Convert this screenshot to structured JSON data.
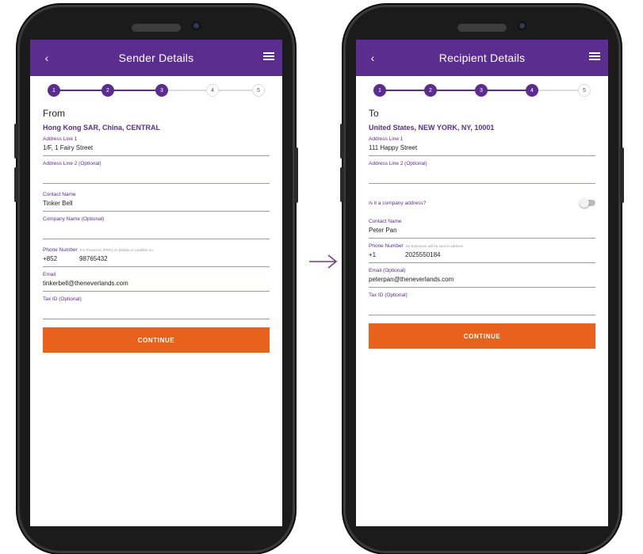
{
  "colors": {
    "brand_purple": "#5b2d8e",
    "cta_orange": "#e8621e",
    "label_purple": "#5b2d8e",
    "arrow": "#7a3d86"
  },
  "sender": {
    "screen_title": "Sender Details",
    "steps": [
      {
        "label": "1",
        "done": true
      },
      {
        "label": "2",
        "done": true
      },
      {
        "label": "3",
        "done": true
      },
      {
        "label": "4",
        "done": false
      },
      {
        "label": "5",
        "done": false
      }
    ],
    "heading": "From",
    "location": "Hong Kong SAR, China,  CENTRAL",
    "address1": {
      "label": "Address Line 1",
      "value": "1/F, 1 Fairy Street"
    },
    "address2": {
      "label": "Address Line 2 (Optional)",
      "value": ""
    },
    "contact": {
      "label": "Contact Name",
      "value": "Tinker Bell"
    },
    "company": {
      "label": "Company Name (Optional)",
      "value": ""
    },
    "phone": {
      "label": "Phone Number",
      "hint": "For Provinces (PRC) no Mobile or Landline no.",
      "code": "+852",
      "value": "98765432"
    },
    "email": {
      "label": "Email",
      "value": "tinkerbell@theneverlands.com"
    },
    "taxid": {
      "label": "Tax ID (Optional)",
      "value": ""
    },
    "cta": "CONTINUE"
  },
  "recipient": {
    "screen_title": "Recipient Details",
    "steps": [
      {
        "label": "1",
        "done": true
      },
      {
        "label": "2",
        "done": true
      },
      {
        "label": "3",
        "done": true
      },
      {
        "label": "4",
        "done": true
      },
      {
        "label": "5",
        "done": false
      }
    ],
    "heading": "To",
    "location": "United States, NEW YORK, NY, 10001",
    "address1": {
      "label": "Address Line 1",
      "value": "111 Happy Street"
    },
    "address2": {
      "label": "Address Line 2 (Optional)",
      "value": ""
    },
    "company_question": "Is it a company address?",
    "contact": {
      "label": "Contact Name",
      "value": "Peter Pan"
    },
    "phone": {
      "label": "Phone Number",
      "hint": "No Extension will be sent to address",
      "code": "+1",
      "value": "2025550184"
    },
    "email": {
      "label": "Email (Optional)",
      "value": "peterpan@theneverlands.com"
    },
    "taxid": {
      "label": "Tax ID (Optional)",
      "value": ""
    },
    "cta": "CONTINUE"
  },
  "icons": {
    "back": "chevron-left-icon",
    "menu": "hamburger-menu-icon",
    "arrow": "arrow-right-icon"
  }
}
